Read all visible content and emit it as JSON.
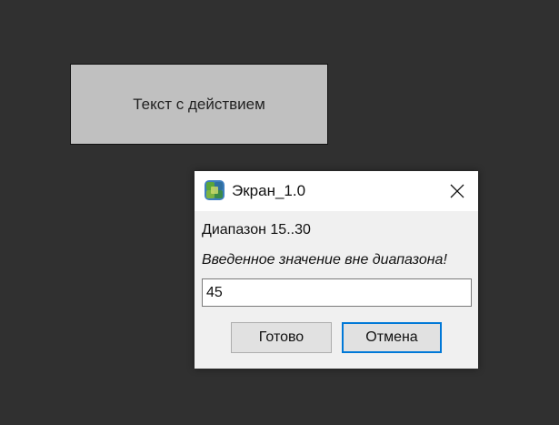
{
  "background": {
    "action_text": "Текст с действием"
  },
  "dialog": {
    "title": "Экран_1.0",
    "range_label": "Диапазон 15..30",
    "error_message": "Введенное значение вне диапазона!",
    "input_value": "45",
    "ok_label": "Готово",
    "cancel_label": "Отмена",
    "icons": {
      "app": "app-icon",
      "close": "close-icon"
    },
    "colors": {
      "focus_border": "#0078d7",
      "panel_bg": "#c0c0c0",
      "backdrop": "#303030"
    }
  }
}
